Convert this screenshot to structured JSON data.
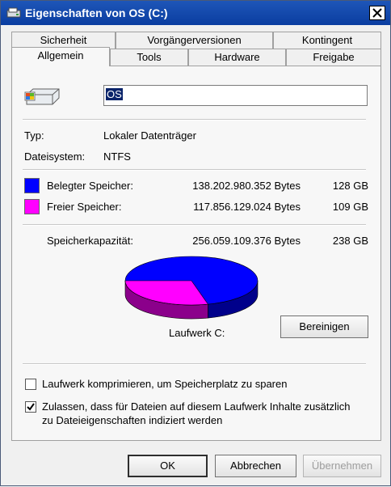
{
  "window": {
    "title": "Eigenschaften von OS (C:)"
  },
  "tabs": {
    "row1": [
      "Sicherheit",
      "Vorgängerversionen",
      "Kontingent"
    ],
    "row2": [
      "Allgemein",
      "Tools",
      "Hardware",
      "Freigabe"
    ],
    "active": "Allgemein"
  },
  "general": {
    "drive_name": "OS",
    "type_label": "Typ:",
    "type_value": "Lokaler Datenträger",
    "fs_label": "Dateisystem:",
    "fs_value": "NTFS",
    "used_label": "Belegter Speicher:",
    "used_bytes": "138.202.980.352 Bytes",
    "used_gb": "128 GB",
    "free_label": "Freier Speicher:",
    "free_bytes": "117.856.129.024 Bytes",
    "free_gb": "109 GB",
    "capacity_label": "Speicherkapazität:",
    "capacity_bytes": "256.059.109.376 Bytes",
    "capacity_gb": "238 GB",
    "drive_label": "Laufwerk C:",
    "cleanup_button": "Bereinigen",
    "used_color": "#0000ff",
    "free_color": "#ff00ff",
    "used_fraction": 0.54
  },
  "options": {
    "compress_label": "Laufwerk komprimieren, um Speicherplatz zu sparen",
    "compress_checked": false,
    "index_label_line1": "Zulassen, dass für Dateien auf diesem Laufwerk Inhalte zusätzlich",
    "index_label_line2": "zu Dateieigenschaften indiziert werden",
    "index_checked": true
  },
  "footer": {
    "ok": "OK",
    "cancel": "Abbrechen",
    "apply": "Übernehmen"
  },
  "icons": [
    "drive-icon",
    "close-icon",
    "checkmark-icon"
  ]
}
